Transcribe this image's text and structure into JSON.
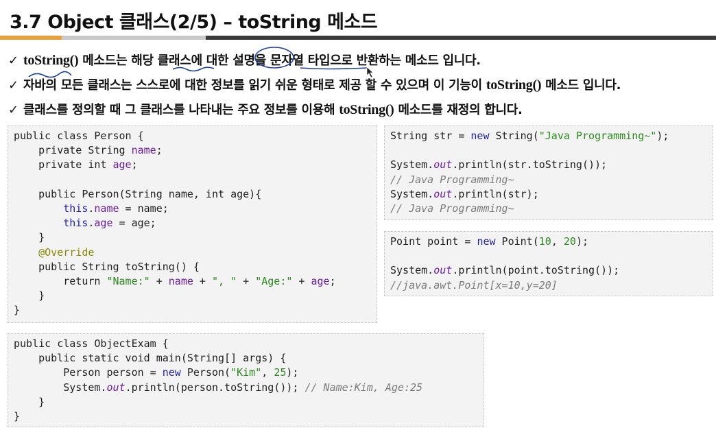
{
  "slide": {
    "title": "3.7 Object 클래스(2/5) – toString 메소드"
  },
  "bullets": [
    {
      "check": "✓",
      "parts": [
        {
          "text": "toString()",
          "serif": true
        },
        {
          "text": " 메소드는 해당 클래스에 대한 설명을 문자열 타입으로 반환하는 메소드 입니다.",
          "serif": false
        }
      ]
    },
    {
      "check": "✓",
      "parts": [
        {
          "text": "자바의 모든 클래스는 스스로에 대한 정보를 읽기 쉬운 형태로 제공 할 수 있으며 이 기능이 ",
          "serif": false
        },
        {
          "text": "toString()",
          "serif": true
        },
        {
          "text": " 메소드 입니다.",
          "serif": false
        }
      ]
    },
    {
      "check": "✓",
      "parts": [
        {
          "text": "클래스를 정의할 때 그 클래스를 나타내는 주요 정보를 이용해 ",
          "serif": false
        },
        {
          "text": "toString()",
          "serif": true
        },
        {
          "text": " 메소드를 재정의 합니다.",
          "serif": false
        }
      ]
    }
  ],
  "code_blocks": {
    "person": [
      [
        {
          "t": "public class Person {",
          "c": "kw"
        }
      ],
      [
        {
          "t": "    private String ",
          "c": "kw"
        },
        {
          "t": "name",
          "c": "fld"
        },
        {
          "t": ";",
          "c": "kw"
        }
      ],
      [
        {
          "t": "    private int ",
          "c": "kw"
        },
        {
          "t": "age",
          "c": "fld"
        },
        {
          "t": ";",
          "c": "kw"
        }
      ],
      [
        {
          "t": "",
          "c": "kw"
        }
      ],
      [
        {
          "t": "    public Person(String name, int age){",
          "c": "kw"
        }
      ],
      [
        {
          "t": "        this",
          "c": "kw2"
        },
        {
          "t": ".",
          "c": "kw"
        },
        {
          "t": "name",
          "c": "fld"
        },
        {
          "t": " = name;",
          "c": "kw"
        }
      ],
      [
        {
          "t": "        this",
          "c": "kw2"
        },
        {
          "t": ".",
          "c": "kw"
        },
        {
          "t": "age",
          "c": "fld"
        },
        {
          "t": " = age;",
          "c": "kw"
        }
      ],
      [
        {
          "t": "    }",
          "c": "kw"
        }
      ],
      [
        {
          "t": "    @Override",
          "c": "ann"
        }
      ],
      [
        {
          "t": "    public String toString() {",
          "c": "kw"
        }
      ],
      [
        {
          "t": "        return ",
          "c": "kw"
        },
        {
          "t": "\"Name:\"",
          "c": "str"
        },
        {
          "t": " + ",
          "c": "kw"
        },
        {
          "t": "name",
          "c": "fld"
        },
        {
          "t": " + ",
          "c": "kw"
        },
        {
          "t": "\", \"",
          "c": "str"
        },
        {
          "t": " + ",
          "c": "kw"
        },
        {
          "t": "\"Age:\"",
          "c": "str"
        },
        {
          "t": " + ",
          "c": "kw"
        },
        {
          "t": "age",
          "c": "fld"
        },
        {
          "t": ";",
          "c": "kw"
        }
      ],
      [
        {
          "t": "    }",
          "c": "kw"
        }
      ],
      [
        {
          "t": "}",
          "c": "kw"
        }
      ]
    ],
    "string_demo": [
      [
        {
          "t": "String str = ",
          "c": "kw"
        },
        {
          "t": "new",
          "c": "kw2"
        },
        {
          "t": " String(",
          "c": "kw"
        },
        {
          "t": "\"Java Programming~\"",
          "c": "str"
        },
        {
          "t": ");",
          "c": "kw"
        }
      ],
      [
        {
          "t": "",
          "c": "kw"
        }
      ],
      [
        {
          "t": "System.",
          "c": "kw"
        },
        {
          "t": "out",
          "c": "it"
        },
        {
          "t": ".println(str.toString());",
          "c": "kw"
        }
      ],
      [
        {
          "t": "// Java Programming~",
          "c": "cmt"
        }
      ],
      [
        {
          "t": "System.",
          "c": "kw"
        },
        {
          "t": "out",
          "c": "it"
        },
        {
          "t": ".println(str);",
          "c": "kw"
        }
      ],
      [
        {
          "t": "// Java Programming~",
          "c": "cmt"
        }
      ]
    ],
    "point_demo": [
      [
        {
          "t": "Point point = ",
          "c": "kw"
        },
        {
          "t": "new",
          "c": "kw2"
        },
        {
          "t": " Point(",
          "c": "kw"
        },
        {
          "t": "10",
          "c": "num"
        },
        {
          "t": ", ",
          "c": "kw"
        },
        {
          "t": "20",
          "c": "num"
        },
        {
          "t": ");",
          "c": "kw"
        }
      ],
      [
        {
          "t": "",
          "c": "kw"
        }
      ],
      [
        {
          "t": "System.",
          "c": "kw"
        },
        {
          "t": "out",
          "c": "it"
        },
        {
          "t": ".println(point.toString());",
          "c": "kw"
        }
      ],
      [
        {
          "t": "//java.awt.Point[x=10,y=20]",
          "c": "cmt"
        }
      ]
    ],
    "exam": [
      [
        {
          "t": "public class ObjectExam {",
          "c": "kw"
        }
      ],
      [
        {
          "t": "    public static void main(String[] args) {",
          "c": "kw"
        }
      ],
      [
        {
          "t": "        Person person = ",
          "c": "kw"
        },
        {
          "t": "new",
          "c": "kw2"
        },
        {
          "t": " Person(",
          "c": "kw"
        },
        {
          "t": "\"Kim\"",
          "c": "str"
        },
        {
          "t": ", ",
          "c": "kw"
        },
        {
          "t": "25",
          "c": "num"
        },
        {
          "t": ");",
          "c": "kw"
        }
      ],
      [
        {
          "t": "        System.",
          "c": "kw"
        },
        {
          "t": "out",
          "c": "it"
        },
        {
          "t": ".println(person.toString()); ",
          "c": "kw"
        },
        {
          "t": "// Name:Kim, Age:25",
          "c": "cmt"
        }
      ],
      [
        {
          "t": "    }",
          "c": "kw"
        }
      ],
      [
        {
          "t": "}",
          "c": "kw"
        }
      ]
    ]
  },
  "colors": {
    "accent": "#e9a23b",
    "annotation_ink": "#1a3f9e"
  }
}
